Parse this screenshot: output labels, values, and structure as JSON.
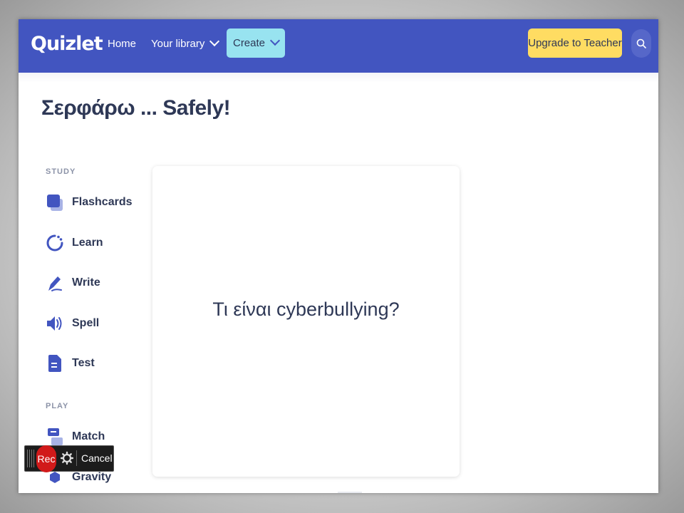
{
  "header": {
    "logo": "Quizlet",
    "nav": {
      "home": "Home",
      "library": "Your library"
    },
    "create_label": "Create",
    "upgrade_label": "Upgrade to Teacher"
  },
  "set_title": "Σερφάρω ... Safely!",
  "sidebar": {
    "study_label": "STUDY",
    "study_items": [
      {
        "label": "Flashcards",
        "icon": "flashcards-icon"
      },
      {
        "label": "Learn",
        "icon": "learn-icon"
      },
      {
        "label": "Write",
        "icon": "write-icon"
      },
      {
        "label": "Spell",
        "icon": "spell-icon"
      },
      {
        "label": "Test",
        "icon": "test-icon"
      }
    ],
    "play_label": "PLAY",
    "play_items": [
      {
        "label": "Match",
        "icon": "match-icon"
      },
      {
        "label": "Gravity",
        "icon": "gravity-icon"
      }
    ]
  },
  "flashcard": {
    "text": "Τι είναι cyberbullying?"
  },
  "recorder": {
    "rec_label": "Rec",
    "cancel_label": "Cancel"
  },
  "colors": {
    "header_bg": "#4255c0",
    "create_bg": "#98e3f0",
    "upgrade_bg": "#ffdc62",
    "text_primary": "#2e3856",
    "icon_blue": "#4255c0",
    "rec_red": "#d11a1a"
  }
}
